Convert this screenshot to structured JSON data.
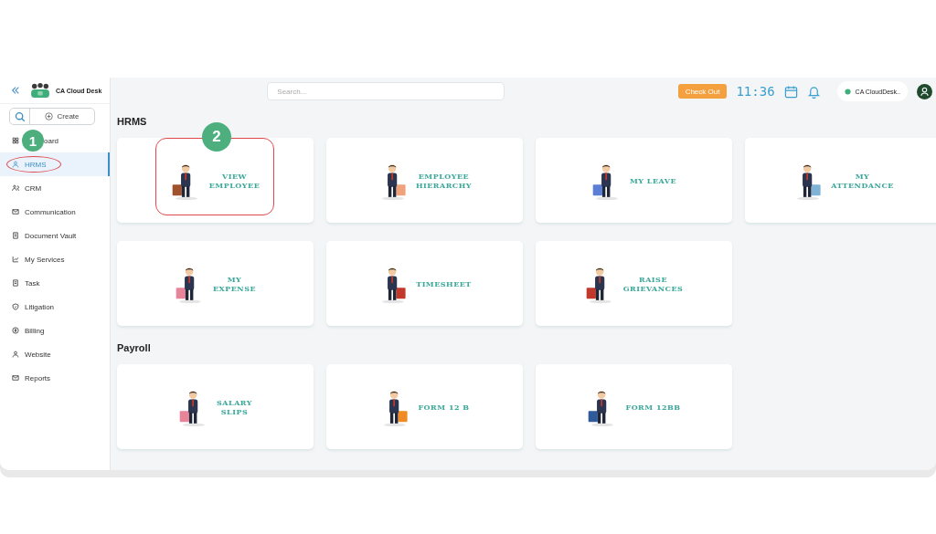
{
  "sidebar": {
    "brand": "CA Cloud Desk",
    "create_label": "Create",
    "items": [
      {
        "label": "oard",
        "selected": false,
        "circled": false,
        "step": "1"
      },
      {
        "label": "HRMS",
        "selected": true,
        "circled": true
      },
      {
        "label": "CRM",
        "selected": false,
        "circled": false
      },
      {
        "label": "Communication",
        "selected": false,
        "circled": false
      },
      {
        "label": "Document Vault",
        "selected": false,
        "circled": false
      },
      {
        "label": "My Services",
        "selected": false,
        "circled": false
      },
      {
        "label": "Task",
        "selected": false,
        "circled": false
      },
      {
        "label": "Litigation",
        "selected": false,
        "circled": false
      },
      {
        "label": "Billing",
        "selected": false,
        "circled": false
      },
      {
        "label": "Website",
        "selected": false,
        "circled": false
      },
      {
        "label": "Reports",
        "selected": false,
        "circled": false
      }
    ]
  },
  "header": {
    "search": {
      "placeholder": "Search..."
    },
    "check_out": "Check Out",
    "time": "11:36",
    "user_name": "CA CloudDesk.."
  },
  "sections": [
    {
      "title": "HRMS",
      "tiles": [
        {
          "label": "VIEW\nEMPLOYEE",
          "highlighted": true,
          "step": "2"
        },
        {
          "label": "EMPLOYEE\nHIERARCHY",
          "highlighted": false
        },
        {
          "label": "MY LEAVE",
          "highlighted": false
        },
        {
          "label": "MY\nATTENDANCE",
          "highlighted": false
        },
        {
          "label": "MY\nEXPENSE",
          "highlighted": false
        },
        {
          "label": "TIMESHEET",
          "highlighted": false
        },
        {
          "label": "RAISE\nGRIEVANCES",
          "highlighted": false
        }
      ]
    },
    {
      "title": "Payroll",
      "tiles": [
        {
          "label": "SALARY\nSLIPS",
          "highlighted": false
        },
        {
          "label": "FORM 12 B",
          "highlighted": false
        },
        {
          "label": "FORM 12BB",
          "highlighted": false
        }
      ]
    }
  ]
}
